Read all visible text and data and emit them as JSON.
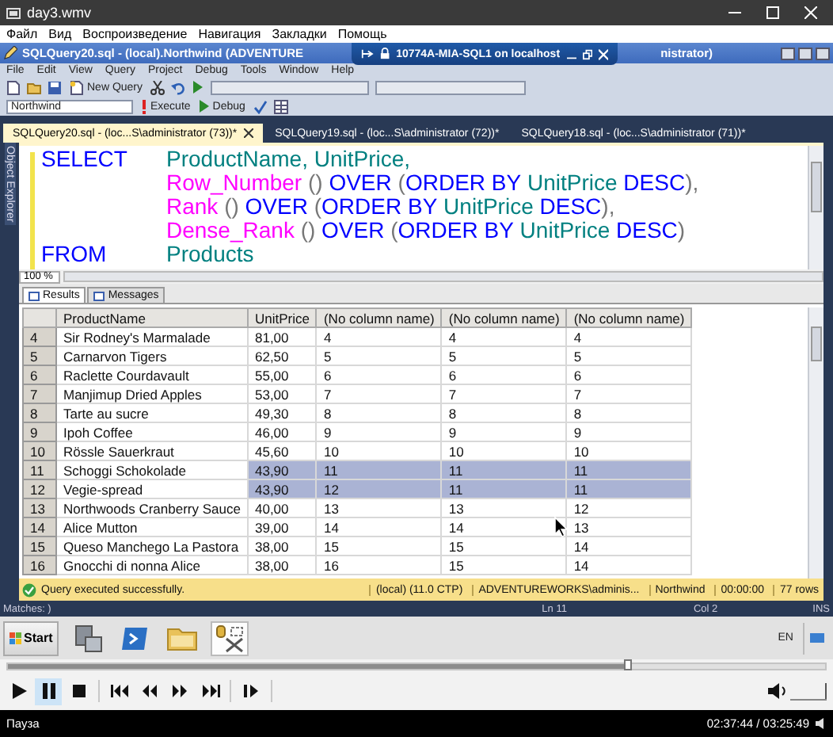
{
  "window": {
    "title": "day3.wmv"
  },
  "menu": [
    "Файл",
    "Вид",
    "Воспроизведение",
    "Навигация",
    "Закладки",
    "Помощь"
  ],
  "ssms": {
    "title": "SQLQuery20.sql - (local).Northwind (ADVENTURE",
    "title_tail": "nistrator)",
    "remote_bar": {
      "title": "10774A-MIA-SQL1 on localhost"
    },
    "menu": [
      "File",
      "Edit",
      "View",
      "Query",
      "Project",
      "Debug",
      "Tools",
      "Window",
      "Help"
    ],
    "toolbar": {
      "new_query": "New Query",
      "database": "Northwind",
      "execute": "Execute",
      "debug": "Debug"
    },
    "tabs": [
      {
        "label": "SQLQuery20.sql - (loc...S\\administrator (73))*",
        "selected": true
      },
      {
        "label": "SQLQuery19.sql - (loc...S\\administrator (72))*",
        "selected": false
      },
      {
        "label": "SQLQuery18.sql - (loc...S\\administrator (71))*",
        "selected": false
      }
    ],
    "side_panel": "Object Explorer",
    "editor": {
      "lines": [
        {
          "lead": "SELECT",
          "tokens": [
            {
              "text": "ProductName, UnitPrice,",
              "kind": "identifier"
            }
          ]
        },
        {
          "tokens": [
            {
              "text": "Row_Number",
              "kind": "function"
            },
            {
              "text": " () ",
              "kind": "punct"
            },
            {
              "text": "OVER",
              "kind": "keyword"
            },
            {
              "text": " (",
              "kind": "punct"
            },
            {
              "text": "ORDER BY",
              "kind": "keyword"
            },
            {
              "text": " UnitPrice",
              "kind": "identifier"
            },
            {
              "text": " DESC",
              "kind": "keyword"
            },
            {
              "text": "),",
              "kind": "punct"
            }
          ]
        },
        {
          "tokens": [
            {
              "text": "Rank",
              "kind": "function"
            },
            {
              "text": " () ",
              "kind": "punct"
            },
            {
              "text": "OVER",
              "kind": "keyword"
            },
            {
              "text": " (",
              "kind": "punct"
            },
            {
              "text": "ORDER BY",
              "kind": "keyword"
            },
            {
              "text": " UnitPrice",
              "kind": "identifier"
            },
            {
              "text": " DESC",
              "kind": "keyword"
            },
            {
              "text": "),",
              "kind": "punct"
            }
          ]
        },
        {
          "tokens": [
            {
              "text": "Dense_Rank",
              "kind": "function"
            },
            {
              "text": " () ",
              "kind": "punct"
            },
            {
              "text": "OVER",
              "kind": "keyword"
            },
            {
              "text": " (",
              "kind": "punct"
            },
            {
              "text": "ORDER BY",
              "kind": "keyword"
            },
            {
              "text": " UnitPrice",
              "kind": "identifier"
            },
            {
              "text": " DESC",
              "kind": "keyword"
            },
            {
              "text": ")",
              "kind": "punct"
            }
          ]
        },
        {
          "lead": "FROM",
          "tokens": [
            {
              "text": "Products",
              "kind": "identifier"
            }
          ]
        }
      ]
    },
    "zoom": "100 %",
    "result_tabs": [
      {
        "label": "Results",
        "selected": true
      },
      {
        "label": "Messages",
        "selected": false
      }
    ],
    "grid": {
      "columns": [
        "ProductName",
        "UnitPrice",
        "(No column name)",
        "(No column name)",
        "(No column name)"
      ],
      "rows": [
        {
          "number": "4",
          "cells": [
            "Sir Rodney's Marmalade",
            "81,00",
            "4",
            "4",
            "4"
          ],
          "selected": false
        },
        {
          "number": "5",
          "cells": [
            "Carnarvon Tigers",
            "62,50",
            "5",
            "5",
            "5"
          ],
          "selected": false
        },
        {
          "number": "6",
          "cells": [
            "Raclette Courdavault",
            "55,00",
            "6",
            "6",
            "6"
          ],
          "selected": false
        },
        {
          "number": "7",
          "cells": [
            "Manjimup Dried Apples",
            "53,00",
            "7",
            "7",
            "7"
          ],
          "selected": false
        },
        {
          "number": "8",
          "cells": [
            "Tarte au sucre",
            "49,30",
            "8",
            "8",
            "8"
          ],
          "selected": false
        },
        {
          "number": "9",
          "cells": [
            "Ipoh Coffee",
            "46,00",
            "9",
            "9",
            "9"
          ],
          "selected": false
        },
        {
          "number": "10",
          "cells": [
            "Rössle Sauerkraut",
            "45,60",
            "10",
            "10",
            "10"
          ],
          "selected": false
        },
        {
          "number": "11",
          "cells": [
            "Schoggi Schokolade",
            "43,90",
            "11",
            "11",
            "11"
          ],
          "selected": true
        },
        {
          "number": "12",
          "cells": [
            "Vegie-spread",
            "43,90",
            "12",
            "11",
            "11"
          ],
          "selected": true
        },
        {
          "number": "13",
          "cells": [
            "Northwoods Cranberry Sauce",
            "40,00",
            "13",
            "13",
            "12"
          ],
          "selected": false
        },
        {
          "number": "14",
          "cells": [
            "Alice Mutton",
            "39,00",
            "14",
            "14",
            "13"
          ],
          "selected": false
        },
        {
          "number": "15",
          "cells": [
            "Queso Manchego La Pastora",
            "38,00",
            "15",
            "15",
            "14"
          ],
          "selected": false
        },
        {
          "number": "16",
          "cells": [
            "Gnocchi di nonna Alice",
            "38,00",
            "16",
            "15",
            "14"
          ],
          "selected": false
        }
      ]
    },
    "status": {
      "message": "Query executed successfully.",
      "segments": [
        "(local) (11.0 CTP)",
        "ADVENTUREWORKS\\adminis...",
        "Northwind",
        "00:00:00",
        "77 rows"
      ]
    },
    "status_bar": {
      "matches": "Matches: )",
      "line": "Ln 11",
      "column": "Col 2",
      "mode": "INS"
    }
  },
  "taskbar": {
    "start": "Start",
    "apps": [
      {
        "kind": "server",
        "selected": false
      },
      {
        "kind": "terminal",
        "selected": false
      },
      {
        "kind": "folder",
        "selected": false
      },
      {
        "kind": "database",
        "selected": true
      }
    ],
    "language": "EN"
  },
  "player_controls": {
    "seek": {
      "level": 0.76
    },
    "buttons": [
      {
        "kind": "play",
        "selected": false
      },
      {
        "kind": "pause",
        "selected": true
      },
      {
        "kind": "stop",
        "selected": false
      },
      {
        "kind": "previous",
        "selected": false
      },
      {
        "kind": "rewind",
        "selected": false
      },
      {
        "kind": "forward",
        "selected": false
      },
      {
        "kind": "next",
        "selected": false
      },
      {
        "kind": "frame-step",
        "selected": false
      }
    ],
    "volume": {
      "level": 0.95
    }
  },
  "player_status": {
    "state": "Пауза",
    "time": "02:37:44 / 03:25:49"
  }
}
